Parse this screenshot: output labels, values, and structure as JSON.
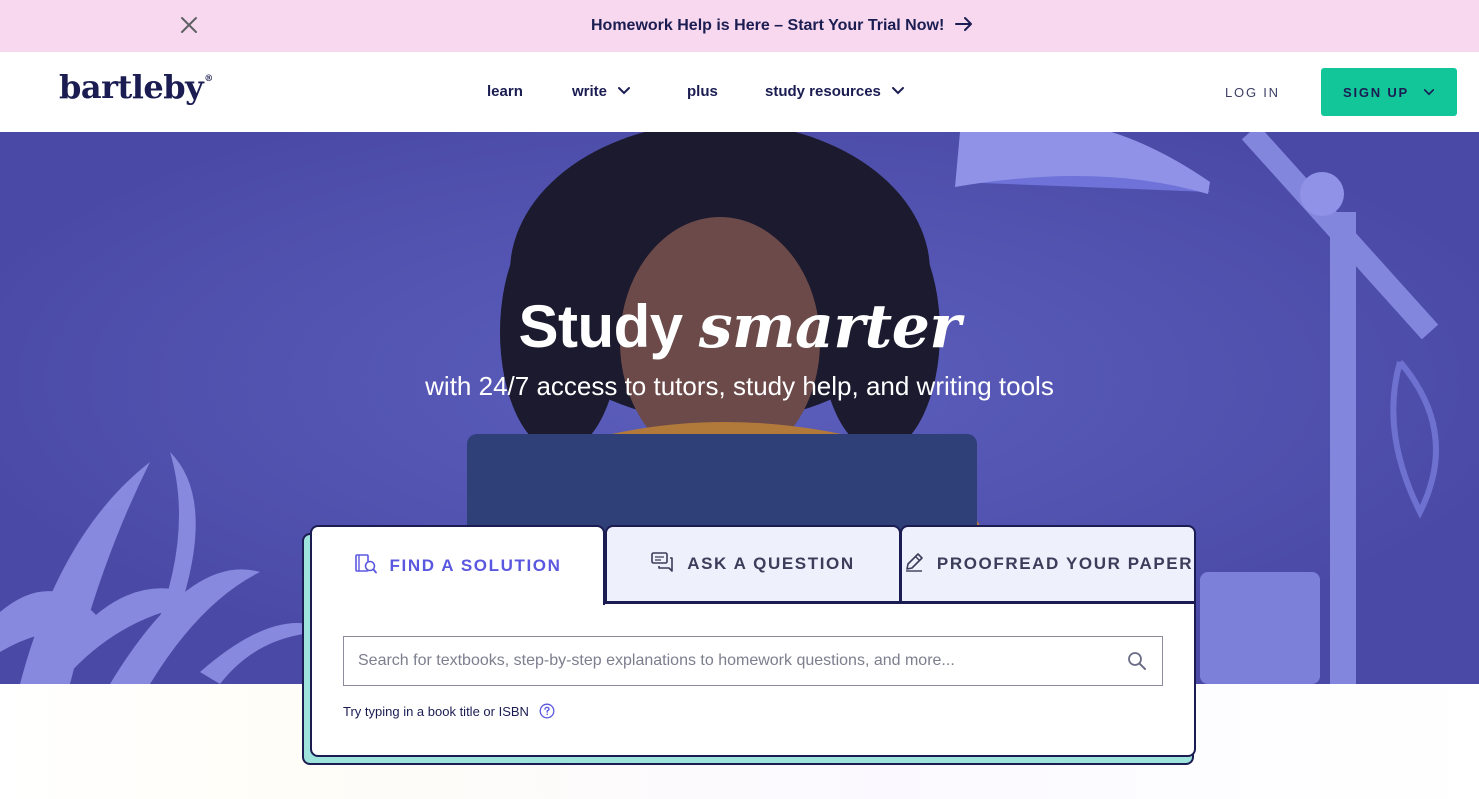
{
  "promo": {
    "text": "Homework Help is Here – Start Your Trial Now!",
    "close_icon": "close-icon",
    "arrow_icon": "arrow-right-icon"
  },
  "header": {
    "logo": "bartleby",
    "logo_mark": "®",
    "nav": [
      {
        "label": "learn",
        "has_dropdown": false
      },
      {
        "label": "write",
        "has_dropdown": true
      },
      {
        "label": "plus",
        "has_dropdown": false
      },
      {
        "label": "study resources",
        "has_dropdown": true
      }
    ],
    "login": "LOG IN",
    "signup": "SIGN UP"
  },
  "hero": {
    "title_plain": "Study",
    "title_emphasis": "smarter",
    "subtitle": "with 24/7 access to tutors, study help, and writing tools"
  },
  "search_widget": {
    "tabs": [
      {
        "label": "FIND A SOLUTION",
        "icon": "textbook-search-icon",
        "active": true
      },
      {
        "label": "ASK A QUESTION",
        "icon": "chat-bubbles-icon",
        "active": false
      },
      {
        "label": "PROOFREAD YOUR PAPER",
        "icon": "pencil-icon",
        "active": false
      }
    ],
    "search": {
      "placeholder": "Search for textbooks, step-by-step explanations to homework questions, and more...",
      "value": ""
    },
    "hint": "Try typing in a book title or ISBN"
  },
  "colors": {
    "promo_bg": "#f7d8ee",
    "navy": "#1b1d52",
    "accent_green": "#13c69a",
    "hero_bg": "#5253b0",
    "active_tab": "#5b58e0",
    "widget_shadow": "#9ee3dc"
  }
}
